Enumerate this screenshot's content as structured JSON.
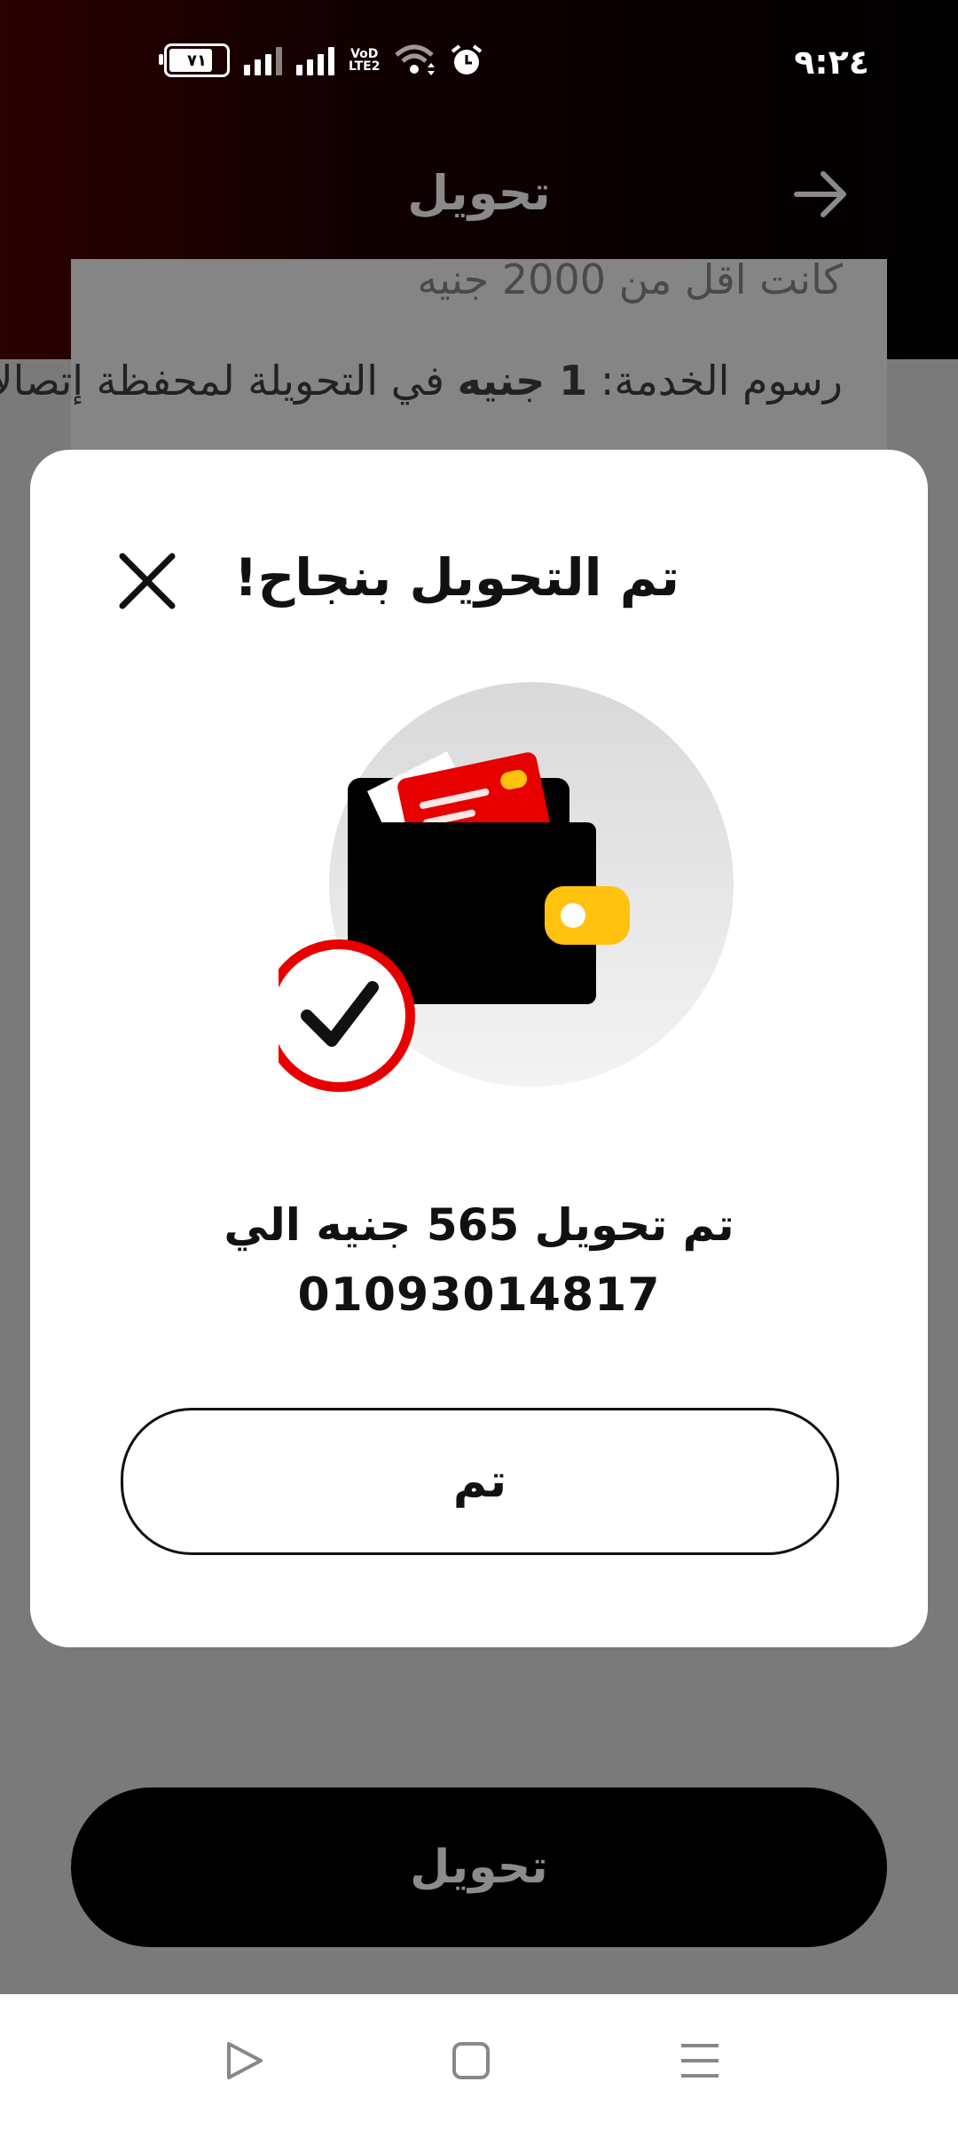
{
  "status_bar": {
    "time": "٩:٢٤",
    "battery": "٧١",
    "network_badge": "VoLTE2"
  },
  "header": {
    "title": "تحويل",
    "back_icon": "arrow-right-icon"
  },
  "background_info": {
    "line1": "كانت اقل من 2000 جنيه",
    "line2_prefix": "رسوم الخدمة: ",
    "line2_amount": "1 جنيه",
    "line2_suffix": " في التحويلة لمحفظة إتصالا"
  },
  "bottom_button": {
    "label": "تحويل"
  },
  "modal": {
    "title": "تم التحويل بنجاح!",
    "close_icon": "close-icon",
    "illustration": "wallet-success-icon",
    "message_line1": "تم تحويل 565 جنيه الي",
    "message_line2": "01093014817",
    "done_label": "تم"
  },
  "nav_bar": {
    "back_icon": "triangle-back-icon",
    "home_icon": "square-home-icon",
    "menu_icon": "menu-icon"
  },
  "colors": {
    "brand_red": "#e60000",
    "accent_yellow": "#ffc20e",
    "overlay_gray": "#7a7a7a"
  }
}
